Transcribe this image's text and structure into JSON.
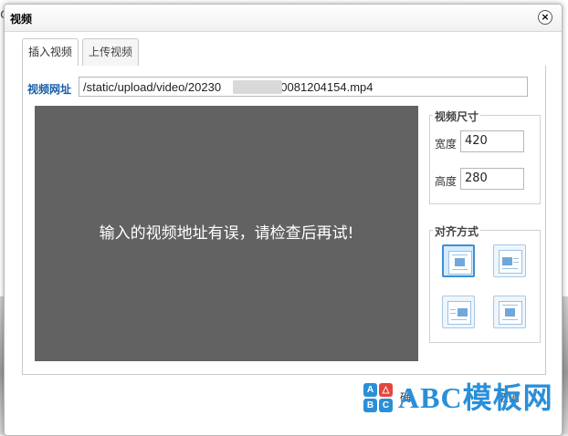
{
  "background": {
    "partial_text": "ole"
  },
  "dialog": {
    "title": "视频",
    "close_glyph": "×",
    "tabs": [
      {
        "label": "插入视频",
        "active": true
      },
      {
        "label": "上传视频",
        "active": false
      }
    ],
    "url": {
      "label": "视频网址",
      "value_prefix": "/static/upload/video/20230",
      "value_suffix": "90081204154.mp4"
    },
    "preview": {
      "message": "输入的视频地址有误，请检查后再试!"
    },
    "size": {
      "legend": "视频尺寸",
      "width_label": "宽度",
      "width_value": "420",
      "height_label": "高度",
      "height_value": "280"
    },
    "align": {
      "legend": "对齐方式",
      "options": [
        "none-align-icon",
        "left-align-icon",
        "right-align-icon",
        "center-align-icon"
      ],
      "selected_index": 0
    },
    "footer": {
      "confirm_partial": "确",
      "cancel_partial": "取消"
    }
  },
  "watermark": {
    "text": "ABC模板网",
    "icon_letters": [
      "A",
      "B",
      "C",
      "△"
    ],
    "colors": {
      "brand_blue": "#2a8fd8"
    }
  },
  "colors": {
    "accent": "#1b5ea8",
    "preview_bg": "#626262",
    "selected_align_border": "#3d8fd6"
  }
}
